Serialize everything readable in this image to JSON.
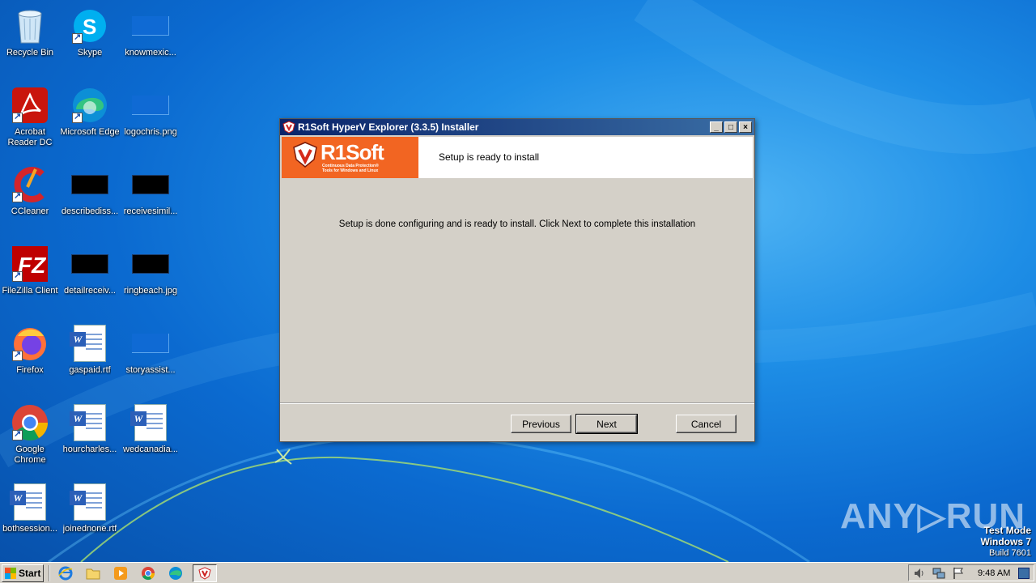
{
  "desktop": {
    "icons": [
      {
        "label": "Recycle Bin",
        "icon": "recycle-bin-icon"
      },
      {
        "label": "Skype",
        "icon": "skype-icon"
      },
      {
        "label": "knowmexic...",
        "icon": "image-thumbnail-icon"
      },
      {
        "label": "Acrobat Reader DC",
        "icon": "acrobat-icon"
      },
      {
        "label": "Microsoft Edge",
        "icon": "edge-icon"
      },
      {
        "label": "logochris.png",
        "icon": "image-thumbnail-icon"
      },
      {
        "label": "CCleaner",
        "icon": "ccleaner-icon"
      },
      {
        "label": "describediss...",
        "icon": "image-thumbnail-icon"
      },
      {
        "label": "receivesimil...",
        "icon": "image-thumbnail-icon"
      },
      {
        "label": "FileZilla Client",
        "icon": "filezilla-icon"
      },
      {
        "label": "detailreceiv...",
        "icon": "image-thumbnail-icon"
      },
      {
        "label": "ringbeach.jpg",
        "icon": "image-thumbnail-icon"
      },
      {
        "label": "Firefox",
        "icon": "firefox-icon"
      },
      {
        "label": "gaspaid.rtf",
        "icon": "word-document-icon"
      },
      {
        "label": "storyassist...",
        "icon": "image-thumbnail-icon"
      },
      {
        "label": "Google Chrome",
        "icon": "chrome-icon"
      },
      {
        "label": "hourcharles...",
        "icon": "word-document-icon"
      },
      {
        "label": "wedcanadia...",
        "icon": "word-document-icon"
      },
      {
        "label": "bothsession...",
        "icon": "word-document-icon"
      },
      {
        "label": "joinednone.rtf",
        "icon": "word-document-icon"
      }
    ]
  },
  "installer": {
    "title": "R1Soft HyperV Explorer (3.3.5) Installer",
    "logo_text": "R1Soft",
    "logo_tagline_1": "Continuous Data Protection®",
    "logo_tagline_2": "Tools for Windows and Linux",
    "header_title": "Setup is ready to install",
    "message": "Setup is done configuring and is ready to install. Click Next to complete this installation",
    "buttons": {
      "previous": "Previous",
      "next": "Next",
      "cancel": "Cancel"
    },
    "controls": {
      "minimize": "_",
      "maximize": "□",
      "close": "×"
    }
  },
  "watermark": {
    "text": "ANY▷RUN"
  },
  "system_info": {
    "line1": "Test Mode",
    "line2": "Windows 7",
    "line3": "Build 7601"
  },
  "taskbar": {
    "start_label": "Start",
    "clock": "9:48 AM",
    "quicklaunch": [
      "ie-icon",
      "folder-icon",
      "media-player-icon",
      "chrome-icon",
      "edge-icon",
      "r1soft-installer-icon"
    ]
  },
  "colors": {
    "accent_orange": "#f26522",
    "titlebar": "#0a246a",
    "desktop_blue": "#1e8ee6"
  }
}
